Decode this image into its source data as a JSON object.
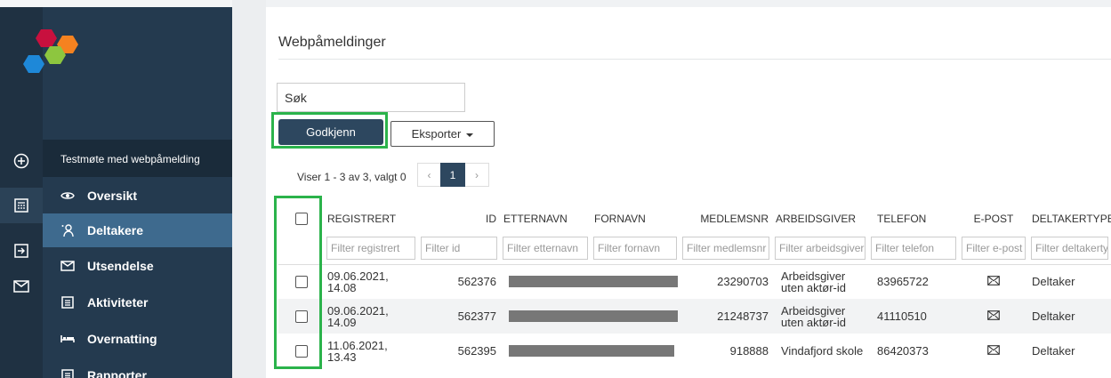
{
  "section_title": "Testmøte med webpåmelding",
  "nav": [
    {
      "label": "Oversikt",
      "icon": "eye-icon"
    },
    {
      "label": "Deltakere",
      "icon": "participants-icon"
    },
    {
      "label": "Utsendelse",
      "icon": "mail-icon"
    },
    {
      "label": "Aktiviteter",
      "icon": "list-icon"
    },
    {
      "label": "Overnatting",
      "icon": "bed-icon"
    },
    {
      "label": "Rapporter",
      "icon": "list-icon"
    }
  ],
  "rail": [
    "plus-circle-icon",
    "calendar-icon",
    "export-icon",
    "mail-icon"
  ],
  "page_title": "Webpåmeldinger",
  "search": {
    "value": "Søk"
  },
  "buttons": {
    "approve": "Godkjenn",
    "export": "Eksporter"
  },
  "pager": {
    "info": "Viser 1 - 3 av 3, valgt 0",
    "prev": "‹",
    "current": "1",
    "next": "›"
  },
  "columns": [
    "REGISTRERT",
    "ID",
    "ETTERNAVN",
    "FORNAVN",
    "MEDLEMSNR",
    "ARBEIDSGIVER",
    "TELEFON",
    "E-POST",
    "DELTAKERTYPE"
  ],
  "filters": [
    "Filter registrert",
    "Filter id",
    "Filter etternavn",
    "Filter fornavn",
    "Filter medlemsnr",
    "Filter arbeidsgiver",
    "Filter telefon",
    "Filter e-post",
    "Filter deltakertype"
  ],
  "rows": [
    {
      "registrert_date": "09.06.2021,",
      "registrert_time": "14.08",
      "id": "562376",
      "medlemsnr": "23290703",
      "arbeidsgiver_1": "Arbeidsgiver",
      "arbeidsgiver_2": "uten aktør-id",
      "telefon": "83965722",
      "deltakertype": "Deltaker"
    },
    {
      "registrert_date": "09.06.2021,",
      "registrert_time": "14.09",
      "id": "562377",
      "medlemsnr": "21248737",
      "arbeidsgiver_1": "Arbeidsgiver",
      "arbeidsgiver_2": "uten aktør-id",
      "telefon": "41110510",
      "deltakertype": "Deltaker"
    },
    {
      "registrert_date": "11.06.2021,",
      "registrert_time": "13.43",
      "id": "562395",
      "medlemsnr": "918888",
      "arbeidsgiver_1": "Vindafjord skole",
      "arbeidsgiver_2": "",
      "telefon": "86420373",
      "deltakertype": "Deltaker"
    }
  ],
  "colors": {
    "sidebar": "#243a4f",
    "rail": "#1f3142",
    "active_nav": "#3e6a8e",
    "primary_button": "#2d475f",
    "highlight": "#2bb34b"
  }
}
